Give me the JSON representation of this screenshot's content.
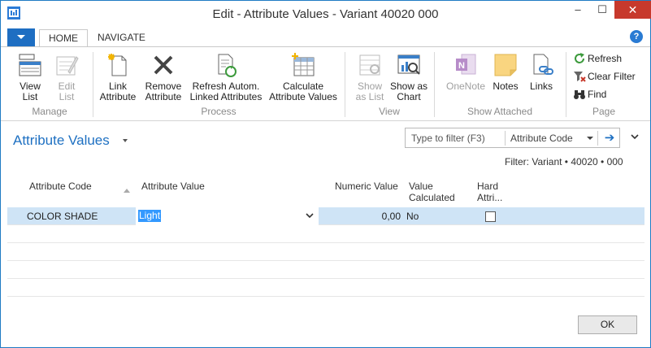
{
  "window": {
    "title": "Edit - Attribute Values - Variant 40020 000",
    "minimize": "–",
    "maximize": "☐",
    "close": "✕"
  },
  "tabs": {
    "home": "HOME",
    "navigate": "NAVIGATE"
  },
  "help": "?",
  "ribbon": {
    "manage": {
      "label": "Manage",
      "view_list": "View\nList",
      "edit_list": "Edit\nList"
    },
    "process": {
      "label": "Process",
      "link_attribute": "Link\nAttribute",
      "remove_attribute": "Remove\nAttribute",
      "refresh_autom": "Refresh Autom.\nLinked Attributes",
      "calculate": "Calculate\nAttribute Values"
    },
    "view": {
      "label": "View",
      "show_as_list": "Show\nas List",
      "show_as_chart": "Show as\nChart"
    },
    "show_attached": {
      "label": "Show Attached",
      "onenote": "OneNote",
      "notes": "Notes",
      "links": "Links"
    },
    "page": {
      "label": "Page",
      "refresh": "Refresh",
      "clear_filter": "Clear Filter",
      "find": "Find"
    }
  },
  "page": {
    "title": "Attribute Values",
    "filter_placeholder": "Type to filter (F3)",
    "filter_field": "Attribute Code",
    "filter_text": "Filter: Variant • 40020 • 000"
  },
  "grid": {
    "headers": {
      "attribute_code": "Attribute Code",
      "attribute_value": "Attribute Value",
      "numeric_value": "Numeric Value",
      "value_calculated": "Value\nCalculated",
      "hard_attri": "Hard\nAttri..."
    },
    "rows": [
      {
        "attribute_code": "COLOR SHADE",
        "attribute_value": "Light",
        "numeric_value": "0,00",
        "value_calculated": "No",
        "hard_attri": false
      }
    ]
  },
  "ok_button": "OK",
  "colors": {
    "accent": "#1e70c2",
    "selected_row": "#cfe4f6",
    "close_button": "#c7392c"
  }
}
